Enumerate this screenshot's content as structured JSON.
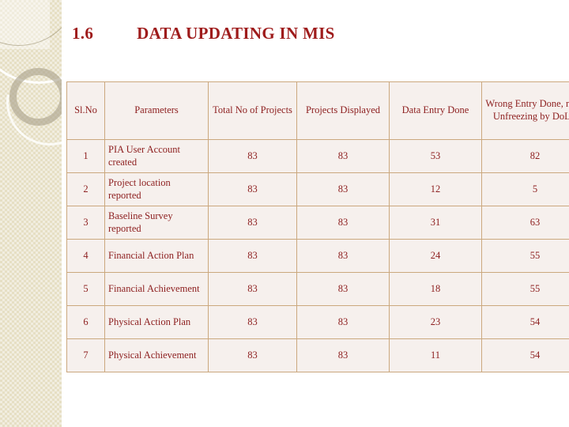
{
  "slide": {
    "title_number": "1.6",
    "title_text": "DATA UPDATING IN MIS",
    "title_color": "#9e1b1b",
    "background_color": "#ffffff",
    "sidebar_color": "#e6dfc4",
    "table_border_color": "#cba87e",
    "table_cell_background": "#f6f0ed",
    "table_text_color": "#8e2121"
  },
  "table": {
    "headers": [
      "Sl.No",
      "Parameters",
      "Total No   of Projects",
      "Projects Displayed",
      "Data Entry Done",
      "Wrong Entry Done, need Unfreezing by DoLR"
    ],
    "rows": [
      {
        "sl": "1",
        "parameter": "PIA User Account created",
        "total": "83",
        "displayed": "83",
        "entry_done": "53",
        "wrong_entry": "82"
      },
      {
        "sl": "2",
        "parameter": "Project location reported",
        "total": "83",
        "displayed": "83",
        "entry_done": "12",
        "wrong_entry": "5"
      },
      {
        "sl": "3",
        "parameter": "Baseline Survey reported",
        "total": "83",
        "displayed": "83",
        "entry_done": "31",
        "wrong_entry": "63"
      },
      {
        "sl": "4",
        "parameter": "Financial Action Plan",
        "total": "83",
        "displayed": "83",
        "entry_done": "24",
        "wrong_entry": "55"
      },
      {
        "sl": "5",
        "parameter": "Financial Achievement",
        "total": "83",
        "displayed": "83",
        "entry_done": "18",
        "wrong_entry": "55"
      },
      {
        "sl": "6",
        "parameter": "Physical Action Plan",
        "total": "83",
        "displayed": "83",
        "entry_done": "23",
        "wrong_entry": "54"
      },
      {
        "sl": "7",
        "parameter": "Physical Achievement",
        "total": "83",
        "displayed": "83",
        "entry_done": "11",
        "wrong_entry": "54"
      }
    ]
  }
}
